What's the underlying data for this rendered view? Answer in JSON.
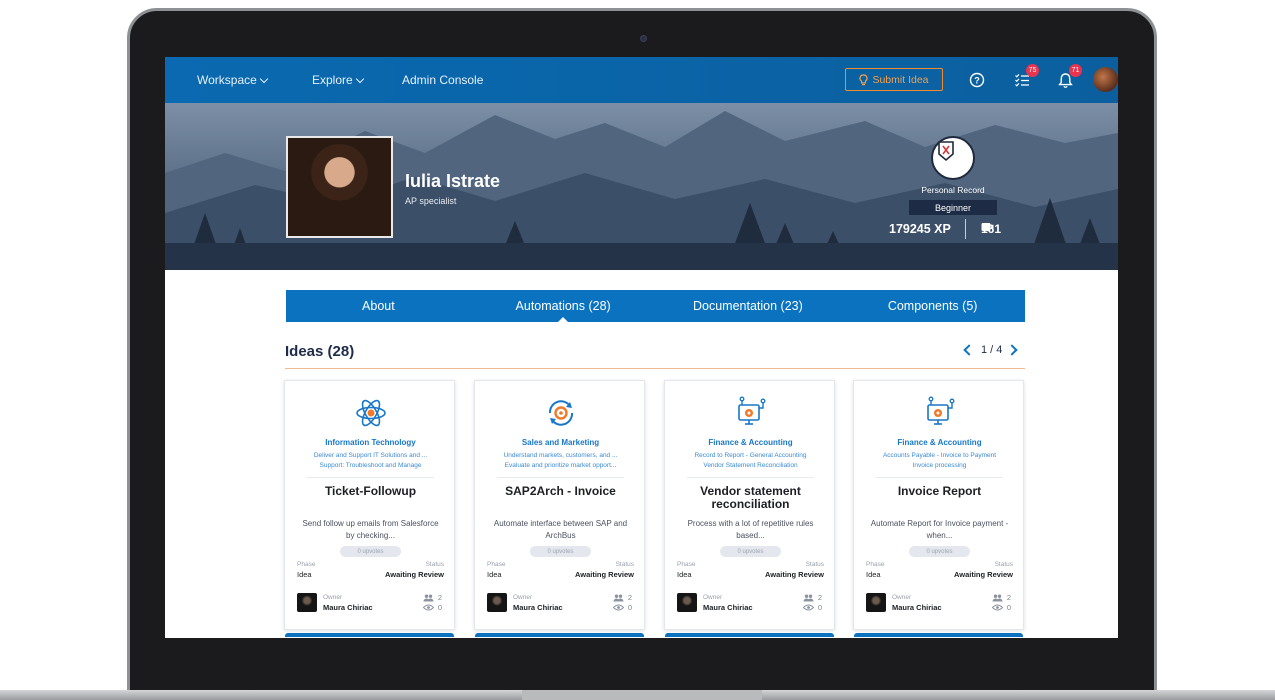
{
  "nav": {
    "workspace": "Workspace",
    "explore": "Explore",
    "admin": "Admin Console",
    "submit_idea": "Submit Idea",
    "tasks_badge": "75",
    "notifications_badge": "71"
  },
  "profile": {
    "name": "Iulia Istrate",
    "role": "AP specialist",
    "record_title": "Personal Record",
    "level": "Beginner",
    "xp": "179245 XP",
    "count": "161"
  },
  "tabs": [
    {
      "label": "About"
    },
    {
      "label": "Automations (28)"
    },
    {
      "label": "Documentation (23)"
    },
    {
      "label": "Components (5)"
    }
  ],
  "ideas": {
    "title": "Ideas (28)",
    "pager": "1 / 4"
  },
  "cards": [
    {
      "icon": "atom-icon",
      "category": "Information Technology",
      "sub": "Deliver and Support IT Solutions and ...\nSupport: Troubleshoot and Manage",
      "title": "Ticket-Followup",
      "desc": "Send follow up emails from Salesforce by checking...",
      "upvotes": "0 upvotes",
      "phase_label": "Phase",
      "phase": "Idea",
      "status_label": "Status",
      "status": "Awaiting Review",
      "owner_label": "Owner",
      "owner": "Maura Chiriac",
      "users": "2",
      "views": "0"
    },
    {
      "icon": "refresh-target-icon",
      "category": "Sales and Marketing",
      "sub": "Understand markets, customers, and ...\nEvaluate and prioritize market opport...",
      "title": "SAP2Arch - Invoice",
      "desc": "Automate interface between SAP and ArchBus",
      "upvotes": "0 upvotes",
      "phase_label": "Phase",
      "phase": "Idea",
      "status_label": "Status",
      "status": "Awaiting Review",
      "owner_label": "Owner",
      "owner": "Maura Chiriac",
      "users": "2",
      "views": "0"
    },
    {
      "icon": "finance-gear-icon",
      "category": "Finance & Accounting",
      "sub": "Record to Report - General Accounting\nVendor Statement Reconciliation",
      "title": "Vendor statement reconciliation",
      "desc": "Process with a lot of repetitive rules based...",
      "upvotes": "0 upvotes",
      "phase_label": "Phase",
      "phase": "Idea",
      "status_label": "Status",
      "status": "Awaiting Review",
      "owner_label": "Owner",
      "owner": "Maura Chiriac",
      "users": "2",
      "views": "0"
    },
    {
      "icon": "finance-gear-icon",
      "category": "Finance & Accounting",
      "sub": "Accounts Payable - Invoice to Payment\nInvoice processing",
      "title": "Invoice Report",
      "desc": "Automate Report for Invoice payment - when...",
      "upvotes": "0 upvotes",
      "phase_label": "Phase",
      "phase": "Idea",
      "status_label": "Status",
      "status": "Awaiting Review",
      "owner_label": "Owner",
      "owner": "Maura Chiriac",
      "users": "2",
      "views": "0"
    }
  ]
}
